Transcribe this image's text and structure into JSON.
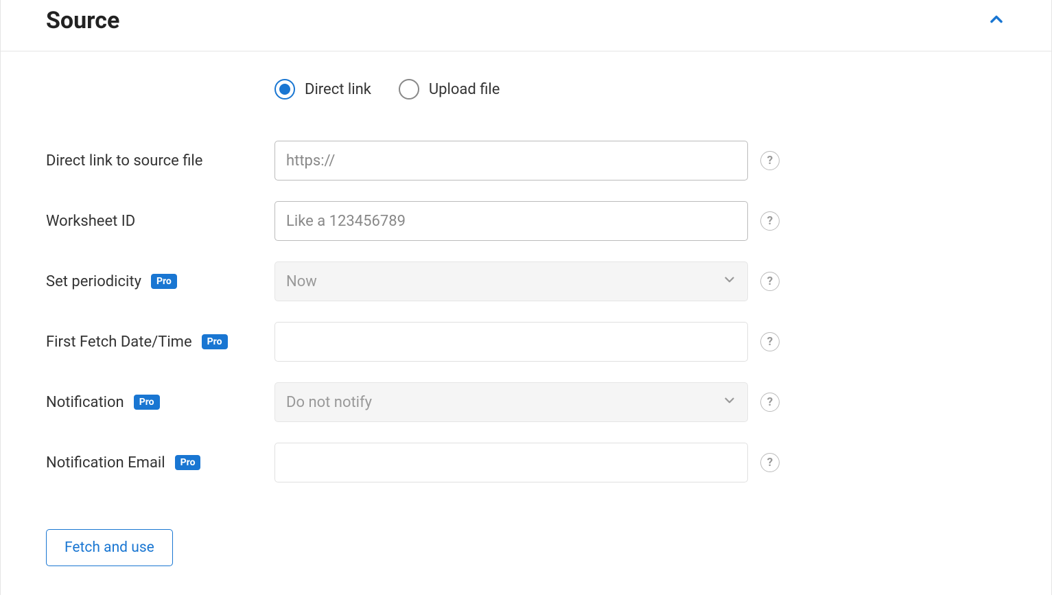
{
  "panel": {
    "title": "Source"
  },
  "radio": {
    "direct_link": "Direct link",
    "upload_file": "Upload file"
  },
  "fields": {
    "direct_link": {
      "label": "Direct link to source file",
      "placeholder": "https://"
    },
    "worksheet_id": {
      "label": "Worksheet ID",
      "placeholder": "Like a 123456789"
    },
    "periodicity": {
      "label": "Set periodicity",
      "value": "Now",
      "pro": "Pro"
    },
    "first_fetch": {
      "label": "First Fetch Date/Time",
      "pro": "Pro"
    },
    "notification": {
      "label": "Notification",
      "value": "Do not notify",
      "pro": "Pro"
    },
    "notification_email": {
      "label": "Notification Email",
      "pro": "Pro"
    }
  },
  "button": {
    "fetch": "Fetch and use"
  }
}
